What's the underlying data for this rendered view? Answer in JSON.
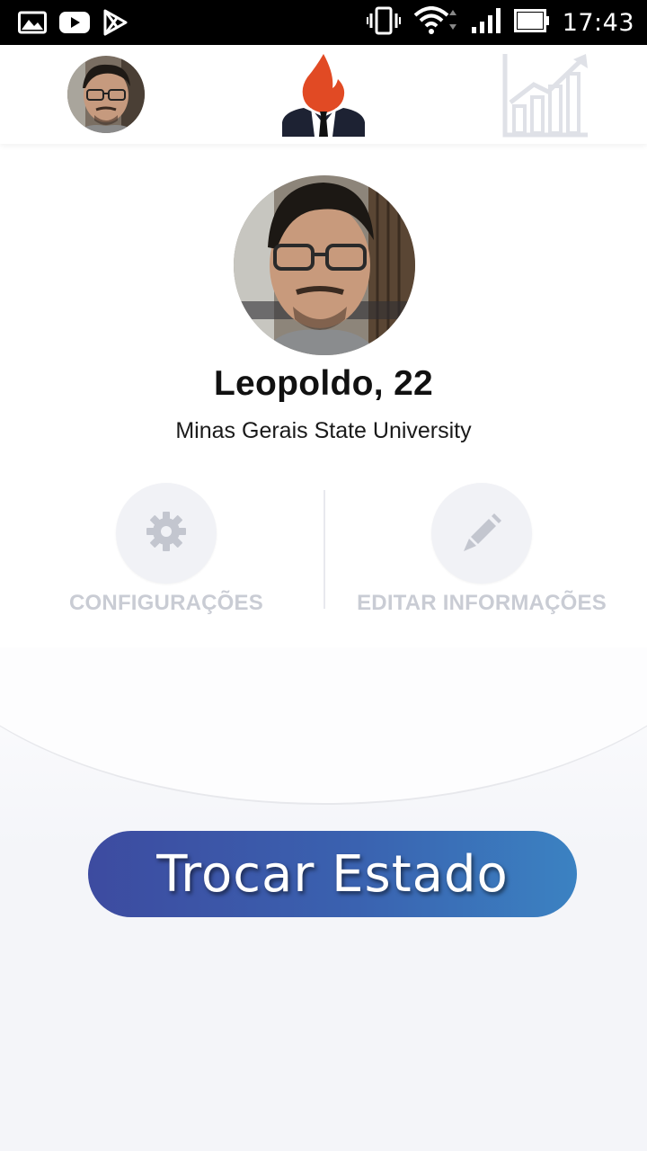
{
  "status_bar": {
    "time": "17:43",
    "left_icons": [
      "gallery-icon",
      "youtube-icon",
      "play-store-icon"
    ],
    "right_icons": [
      "vibrate-icon",
      "wifi-icon",
      "signal-icon",
      "battery-icon"
    ]
  },
  "nav": {
    "left": "profile-avatar",
    "center": "app-logo",
    "right": "stats-chart-icon"
  },
  "profile": {
    "name": "Leopoldo, 22",
    "school": "Minas Gerais State University"
  },
  "actions": {
    "settings_label": "CONFIGURAÇÕES",
    "edit_label": "EDITAR INFORMAÇÕES"
  },
  "main_button": {
    "label": "Trocar Estado"
  },
  "colors": {
    "accent_start": "#3d4ba0",
    "accent_end": "#3b82c2",
    "flame": "#e14a24",
    "muted_label": "#c9ccd4"
  }
}
